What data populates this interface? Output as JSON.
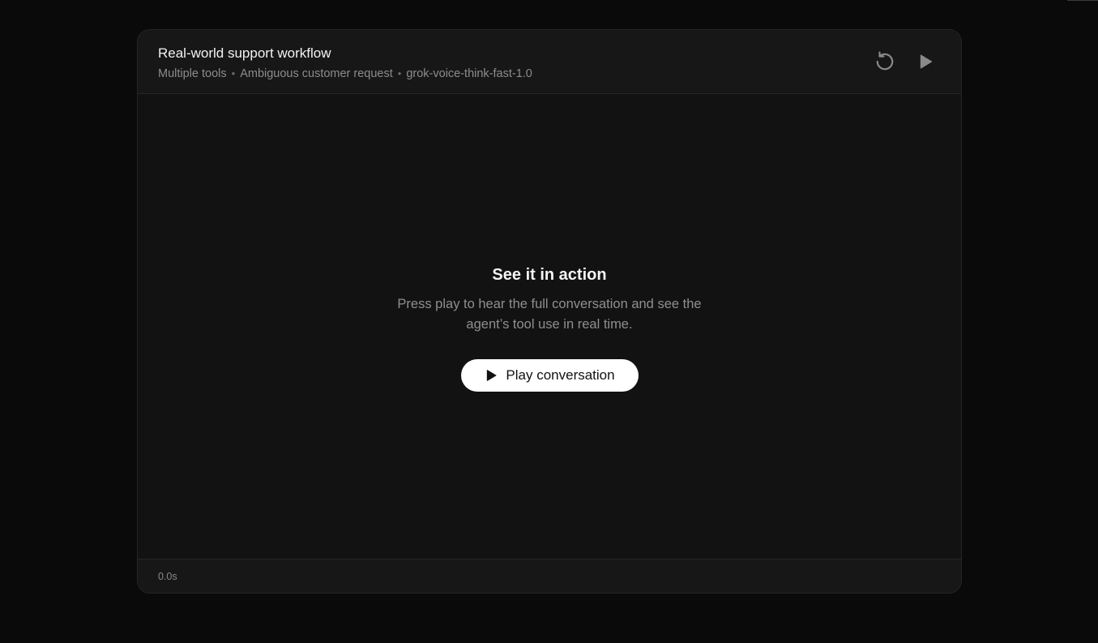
{
  "card": {
    "title": "Real-world support workflow",
    "tags": [
      "Multiple tools",
      "Ambiguous customer request",
      "grok-voice-think-fast-1.0"
    ],
    "separator": "•",
    "controls": {
      "restart_icon": "restart-icon",
      "play_icon": "play-icon"
    }
  },
  "cta": {
    "heading": "See it in action",
    "description": "Press play to hear the full conversation and see the agent’s tool use in real time.",
    "button_label": "Play conversation",
    "button_icon": "play-icon"
  },
  "footer": {
    "elapsed": "0.0s"
  },
  "colors": {
    "page_background": "#0a0a0a",
    "card_background": "#121212",
    "header_background": "#171717",
    "button_background": "#ffffff",
    "icon_gray": "#8a8a8a"
  }
}
